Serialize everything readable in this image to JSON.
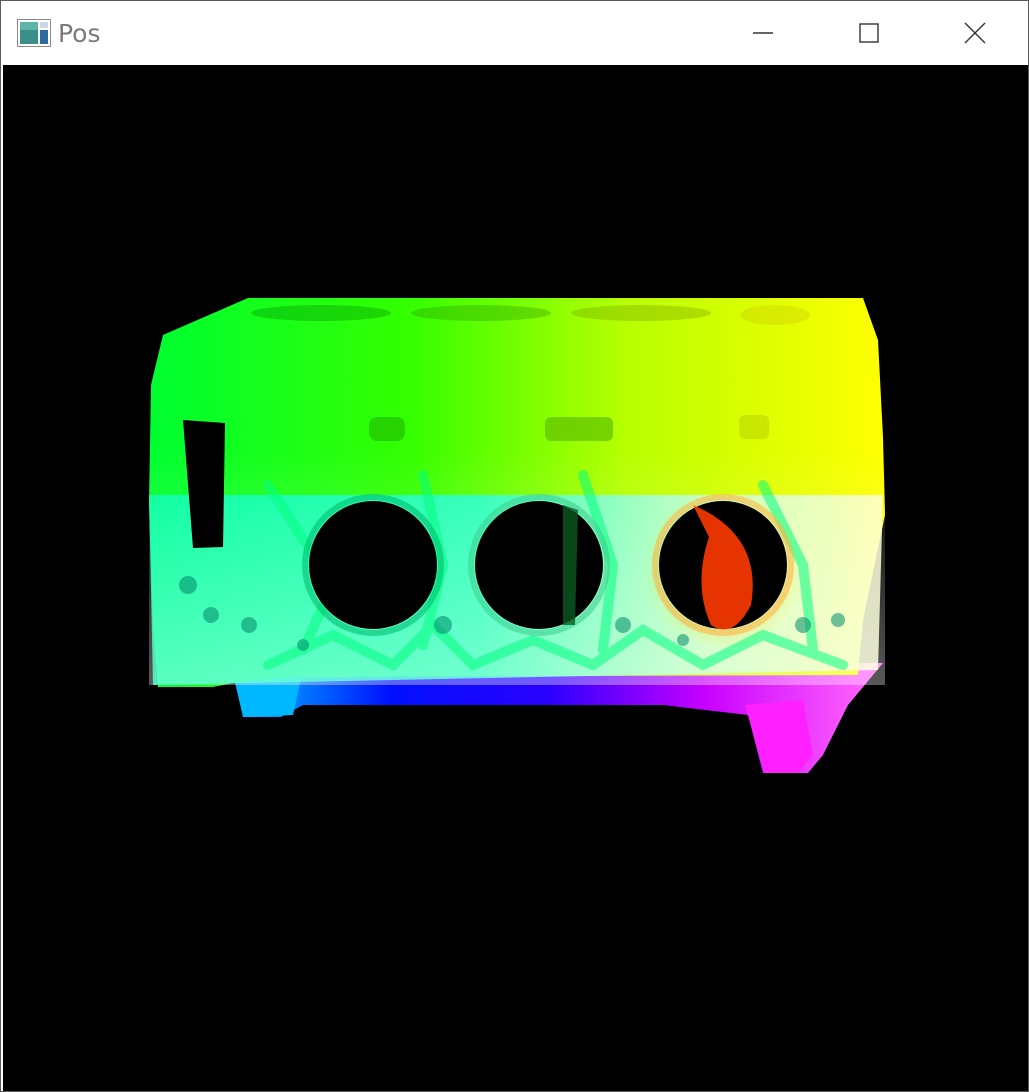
{
  "window": {
    "title": "Pos",
    "icon": "application-icon"
  },
  "controls": {
    "minimize": "minimize-icon",
    "maximize": "maximize-icon",
    "close": "close-icon"
  },
  "viewport": {
    "background": "#000000",
    "content": "engine-block-position-render"
  },
  "colors": {
    "green": "#00ff00",
    "yellow": "#ffff00",
    "cyan": "#00ffd0",
    "blue": "#0000ff",
    "magenta": "#ff00ff",
    "red": "#ff2a00"
  }
}
